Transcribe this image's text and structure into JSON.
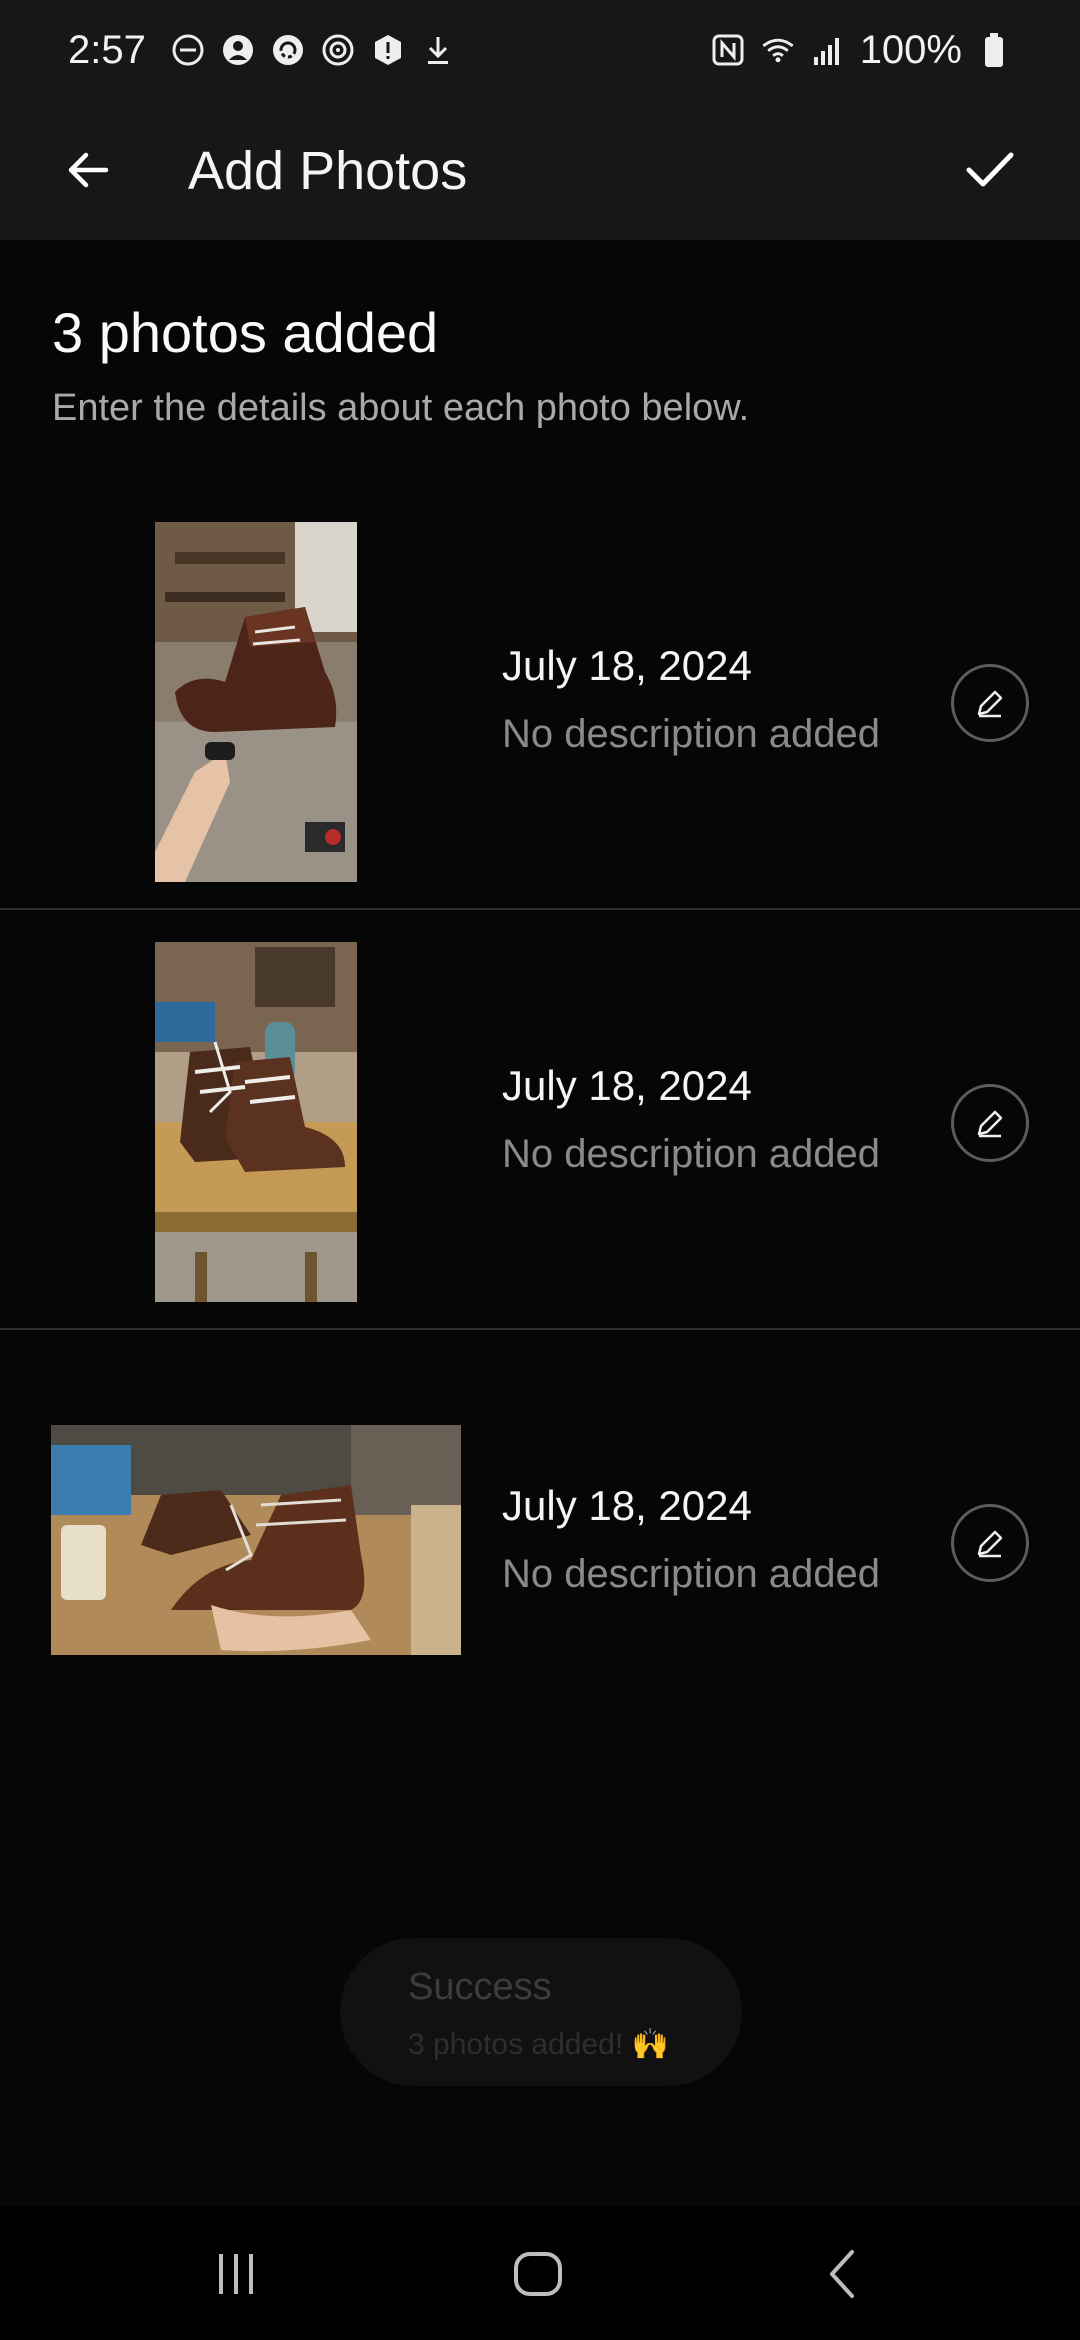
{
  "status_bar": {
    "time": "2:57",
    "battery": "100%",
    "left_icons": [
      "dnd-icon",
      "account-icon",
      "sync-icon",
      "target-icon",
      "alert-icon",
      "download-icon"
    ],
    "right_icons": [
      "nfc-icon",
      "wifi-icon",
      "signal-icon",
      "battery-icon"
    ]
  },
  "app_bar": {
    "title": "Add Photos"
  },
  "header": {
    "title": "3 photos added",
    "subtitle": "Enter the details about each photo below."
  },
  "photos": [
    {
      "date": "July 18, 2024",
      "description": "No description added",
      "orientation": "portrait"
    },
    {
      "date": "July 18, 2024",
      "description": "No description added",
      "orientation": "portrait"
    },
    {
      "date": "July 18, 2024",
      "description": "No description added",
      "orientation": "landscape"
    }
  ],
  "toast": {
    "title": "Success",
    "message": "3 photos added! 🙌"
  },
  "colors": {
    "background": "#060606",
    "app_bar": "#171717",
    "divider": "#2f2f2f",
    "secondary_text": "#8a8a8a"
  }
}
